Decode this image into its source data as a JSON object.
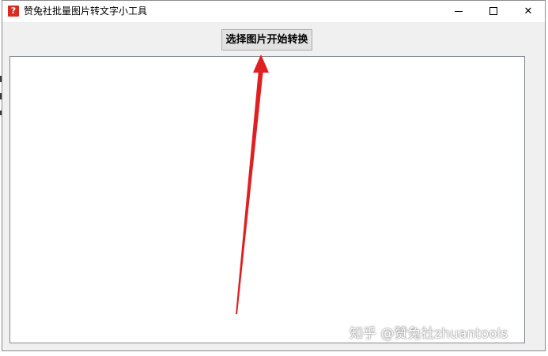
{
  "window": {
    "title": "赞兔社批量图片转文字小工具",
    "icon": "question-mark-app-icon",
    "controls": {
      "minimize": "minimize-icon",
      "maximize": "maximize-icon",
      "close_glyph": "✕"
    }
  },
  "toolbar": {
    "convert_button_label": "选择图片开始转换"
  },
  "output": {
    "text": ""
  },
  "overlay": {
    "watermark": "知乎 @赞兔社zhuantools",
    "arrow_color": "#e02020"
  }
}
